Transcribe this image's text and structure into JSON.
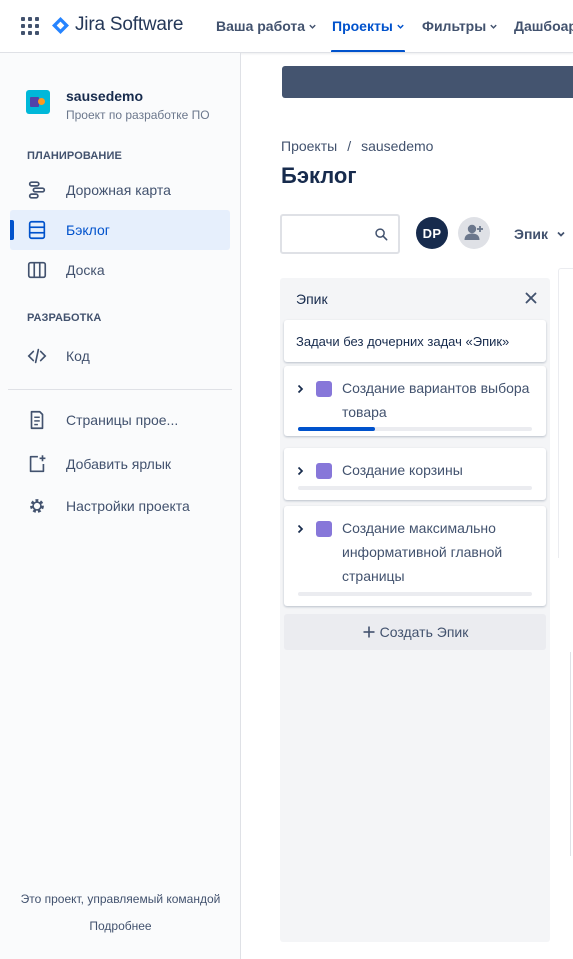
{
  "topnav": {
    "product_name": "Jira Software",
    "items": [
      {
        "label": "Ваша работа",
        "active": false
      },
      {
        "label": "Проекты",
        "active": true
      },
      {
        "label": "Фильтры",
        "active": false
      },
      {
        "label": "Дашбоар",
        "active": false
      }
    ]
  },
  "sidebar": {
    "project_name": "sausedemo",
    "project_type": "Проект по разработке ПО",
    "sections": {
      "planning": "ПЛАНИРОВАНИЕ",
      "development": "РАЗРАБОТКА"
    },
    "items": [
      {
        "label": "Дорожная карта",
        "icon": "roadmap-icon"
      },
      {
        "label": "Бэклог",
        "icon": "backlog-icon",
        "selected": true
      },
      {
        "label": "Доска",
        "icon": "board-icon"
      },
      {
        "label": "Код",
        "icon": "code-icon"
      },
      {
        "label": "Страницы прое...",
        "icon": "pages-icon"
      },
      {
        "label": "Добавить ярлык",
        "icon": "add-shortcut-icon"
      },
      {
        "label": "Настройки проекта",
        "icon": "gear-icon"
      }
    ],
    "footer_text": "Это проект, управляемый командой",
    "footer_link": "Подробнее"
  },
  "main": {
    "breadcrumbs": [
      "Проекты",
      "/",
      "sausedemo"
    ],
    "title": "Бэклог",
    "search_placeholder": "",
    "avatar_initials": "DP",
    "epic_filter_label": "Эпик"
  },
  "epic_panel": {
    "title": "Эпик",
    "unassigned_label": "Задачи без дочерних задач «Эпик»",
    "epics": [
      {
        "name": "Создание вариантов выбора товара",
        "progress": 0.33
      },
      {
        "name": "Создание корзины",
        "progress": 0
      },
      {
        "name": "Создание максимально информативной главной страницы",
        "progress": 0
      }
    ],
    "create_label": "Создать Эпик"
  },
  "colors": {
    "accent": "#0052cc",
    "epic_swatch": "#8777d9",
    "avatar_dark": "#172b4d"
  }
}
